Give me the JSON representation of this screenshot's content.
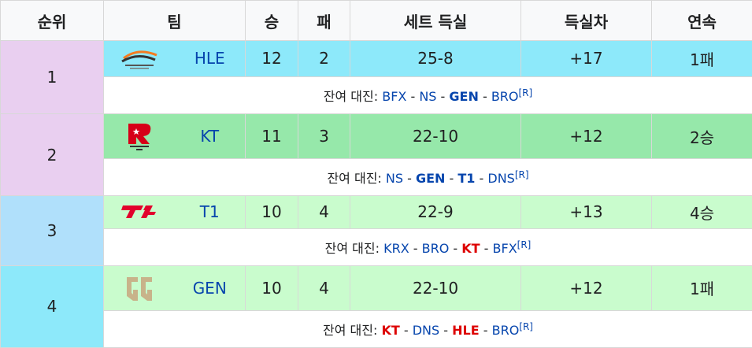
{
  "headers": [
    "순위",
    "팀",
    "승",
    "패",
    "세트 득실",
    "득실차",
    "연속"
  ],
  "remaining_label": "잔여 대진:",
  "ref": "[R]",
  "colors": {
    "purple": "#e9cff0",
    "cyan": "#8de9fa",
    "blue": "#b0e0fb",
    "green1": "#96e8aa",
    "green2": "#c9fccd"
  },
  "rows": [
    {
      "rank": "1",
      "rank_color": "#e9cff0",
      "row_color": "#8de9fa",
      "team": "HLE",
      "logo_icon": "hle-logo-icon",
      "wins": "12",
      "losses": "2",
      "sets": "25-8",
      "diff": "+17",
      "streak": "1패",
      "remaining": [
        {
          "name": "BFX",
          "bold": false,
          "red": false
        },
        {
          "name": "NS",
          "bold": false,
          "red": false
        },
        {
          "name": "GEN",
          "bold": true,
          "red": false
        },
        {
          "name": "BRO",
          "bold": false,
          "red": false
        }
      ]
    },
    {
      "rank": "2",
      "rank_color": "#e9cff0",
      "row_color": "#96e8aa",
      "team": "KT",
      "logo_icon": "kt-rolster-logo-icon",
      "wins": "11",
      "losses": "3",
      "sets": "22-10",
      "diff": "+12",
      "streak": "2승",
      "remaining": [
        {
          "name": "NS",
          "bold": false,
          "red": false
        },
        {
          "name": "GEN",
          "bold": true,
          "red": false
        },
        {
          "name": "T1",
          "bold": true,
          "red": false
        },
        {
          "name": "DNS",
          "bold": false,
          "red": false
        }
      ]
    },
    {
      "rank": "3",
      "rank_color": "#b0e0fb",
      "row_color": "#c9fccd",
      "team": "T1",
      "logo_icon": "t1-logo-icon",
      "wins": "10",
      "losses": "4",
      "sets": "22-9",
      "diff": "+13",
      "streak": "4승",
      "remaining": [
        {
          "name": "KRX",
          "bold": false,
          "red": false
        },
        {
          "name": "BRO",
          "bold": false,
          "red": false
        },
        {
          "name": "KT",
          "bold": true,
          "red": true
        },
        {
          "name": "BFX",
          "bold": false,
          "red": false
        }
      ]
    },
    {
      "rank": "4",
      "rank_color": "#8de9fa",
      "row_color": "#c9fccd",
      "team": "GEN",
      "logo_icon": "gen-g-logo-icon",
      "wins": "10",
      "losses": "4",
      "sets": "22-10",
      "diff": "+12",
      "streak": "1패",
      "remaining": [
        {
          "name": "KT",
          "bold": true,
          "red": true
        },
        {
          "name": "DNS",
          "bold": false,
          "red": false
        },
        {
          "name": "HLE",
          "bold": true,
          "red": true
        },
        {
          "name": "BRO",
          "bold": false,
          "red": false
        }
      ]
    }
  ]
}
